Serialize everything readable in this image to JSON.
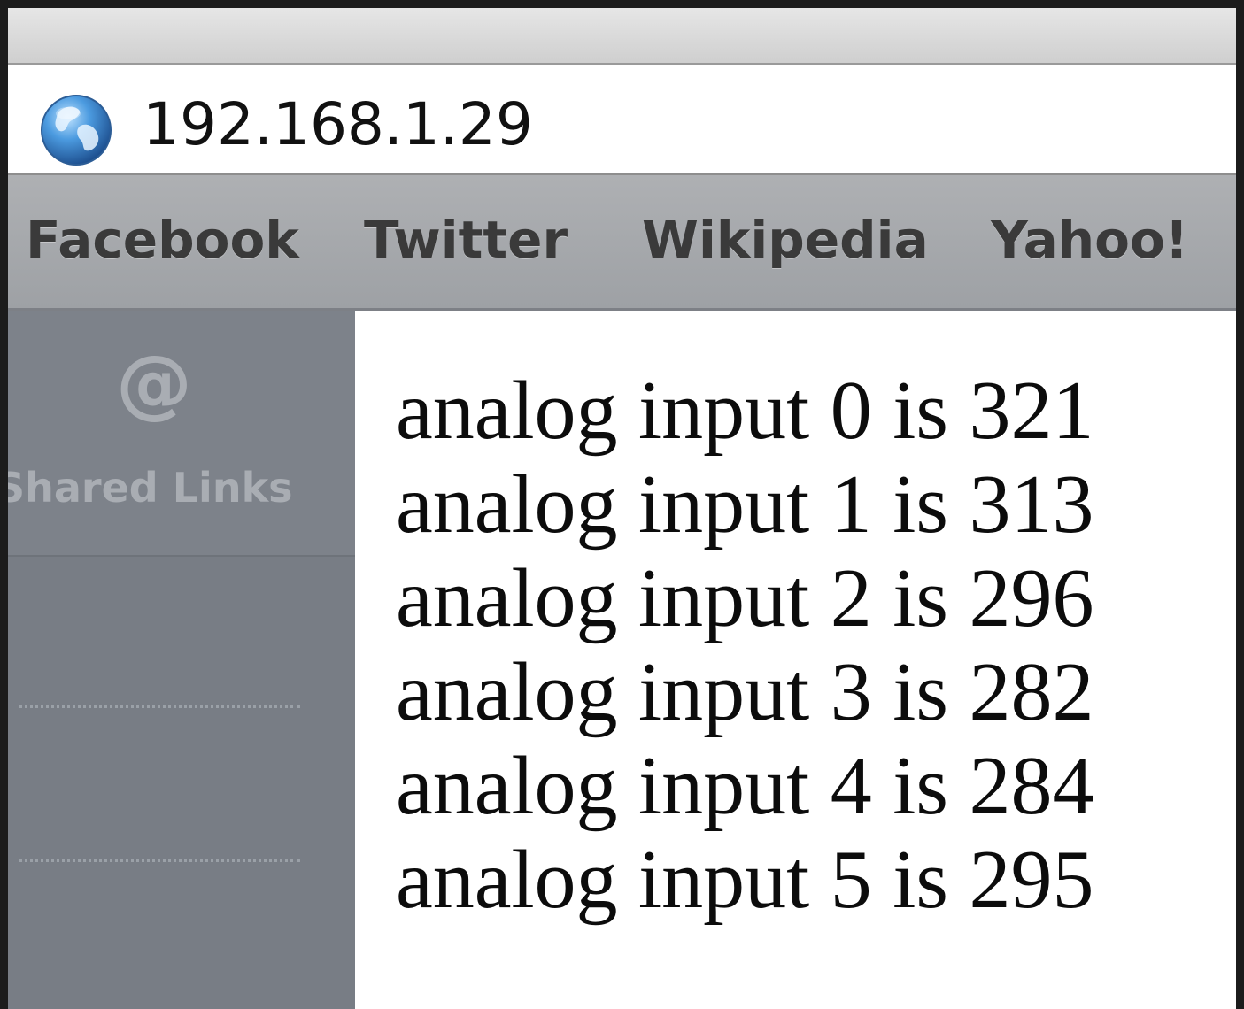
{
  "address_bar": {
    "url": "192.168.1.29",
    "icon": "globe-icon"
  },
  "bookmarks": [
    {
      "label": "Facebook"
    },
    {
      "label": "Twitter"
    },
    {
      "label": "Wikipedia"
    },
    {
      "label": "Yahoo!"
    }
  ],
  "sidebar": {
    "shared_links": {
      "icon_glyph": "@",
      "icon": "at-icon",
      "label": "Shared Links"
    }
  },
  "content": {
    "readings": [
      "analog input 0 is 321",
      "analog input 1 is 313",
      "analog input 2 is 296",
      "analog input 3 is 282",
      "analog input 4 is 284",
      "analog input 5 is 295"
    ]
  },
  "colors": {
    "sidebar": "#787d85",
    "bookmarks_bar": "#a6a9ad",
    "page_background": "#ffffff",
    "text": "#0c0c0c"
  }
}
